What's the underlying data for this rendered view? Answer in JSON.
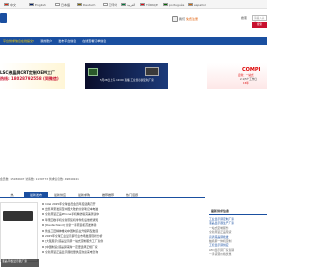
{
  "langbar": {
    "items": [
      {
        "label": "中文",
        "flag": "#de2910"
      },
      {
        "label": "English",
        "flag": "#012169"
      },
      {
        "label": "日本語",
        "flag": "#ffffff"
      },
      {
        "label": "Deutsch",
        "flag": "#000000"
      },
      {
        "label": "한국어",
        "flag": "#ffffff"
      },
      {
        "label": "العربية",
        "flag": "#007a3d"
      },
      {
        "label": "TÜRKÇE",
        "flag": "#e30a17"
      },
      {
        "label": "português",
        "flag": "#006600"
      },
      {
        "label": "español",
        "flag": "#aa151b"
      }
    ]
  },
  "header": {
    "user_links": [
      "我们",
      "免费注册"
    ],
    "search_label": "搜索",
    "search_placeholder": "请输入关键",
    "search_button": "搜索"
  },
  "nav": {
    "items": [
      {
        "label": "平台供求信息在线提交!",
        "hot": true
      },
      {
        "label": "我的账户"
      },
      {
        "label": "发布平台信息"
      },
      {
        "label": "在线查看订单信息"
      }
    ]
  },
  "banners": {
    "b1_line1": "LSC液晶屏CRT定制OEM工厂",
    "b1_line2": "热线: 18028792558 (同微信)",
    "b2_text": "5月28日上午 10:00 直播   工业显示屏定制厂家",
    "b3_brand": "COMPI",
    "b3_sub1": "定制：一站式",
    "b3_sub2": "2.1/5个工作日",
    "b3_sub3": "15年"
  },
  "stats": {
    "text": "会员数: 15936607  访客数: 1139773  供求信息数: 49849241"
  },
  "news": {
    "tabs": [
      {
        "label": "热"
      },
      {
        "label": "最新发布",
        "active": true
      },
      {
        "label": "最新供应"
      },
      {
        "label": "最新求购"
      },
      {
        "label": "推荐推荐"
      },
      {
        "label": "热门话题"
      }
    ],
    "thumb_caption": "液晶平板显示器厂家",
    "items": [
      "Intel 2025年全球会员会员年度盛典召开",
      "出售苹果发货至中国大陆的全新笔记本电脑",
      "全新原装正品iPhone手机精仿版完美测试中",
      "苹果回收手机全新原装机零件售后维修通知",
      "[Deutschland] 全新一手原装机首发体验",
      "鲁班工匠精神推动中国制造业升级转型发展",
      "2025年全球工业显示屏行业市场发展现状分析",
      "[大阪展示]液晶显示屏一站式定制服务工厂直供",
      "[中国制造]液晶屏采购一定要选择正规厂家",
      "全新原装正品显示器批量供应欢迎来电咨询"
    ]
  },
  "side": {
    "title": "最新供求信息",
    "items": [
      {
        "text": "工业显示屏定制厂家",
        "style": "link"
      },
      {
        "text": "液晶显示器生产厂家",
        "style": "link"
      },
      {
        "text": "一站式定制服务",
        "style": "gray"
      },
      {
        "text": "全新原装正品现货",
        "style": "gray"
      },
      {
        "text": "高清液晶屏批发",
        "style": "link"
      },
      {
        "text": "触摸屏一体机定制",
        "style": "gray"
      },
      {
        "text": "工控显示屏供应",
        "style": "link"
      },
      {
        "text": "LED显示屏厂家直销",
        "style": "gray"
      },
      {
        "text": "一手货源价格优惠",
        "style": "gray"
      }
    ]
  }
}
